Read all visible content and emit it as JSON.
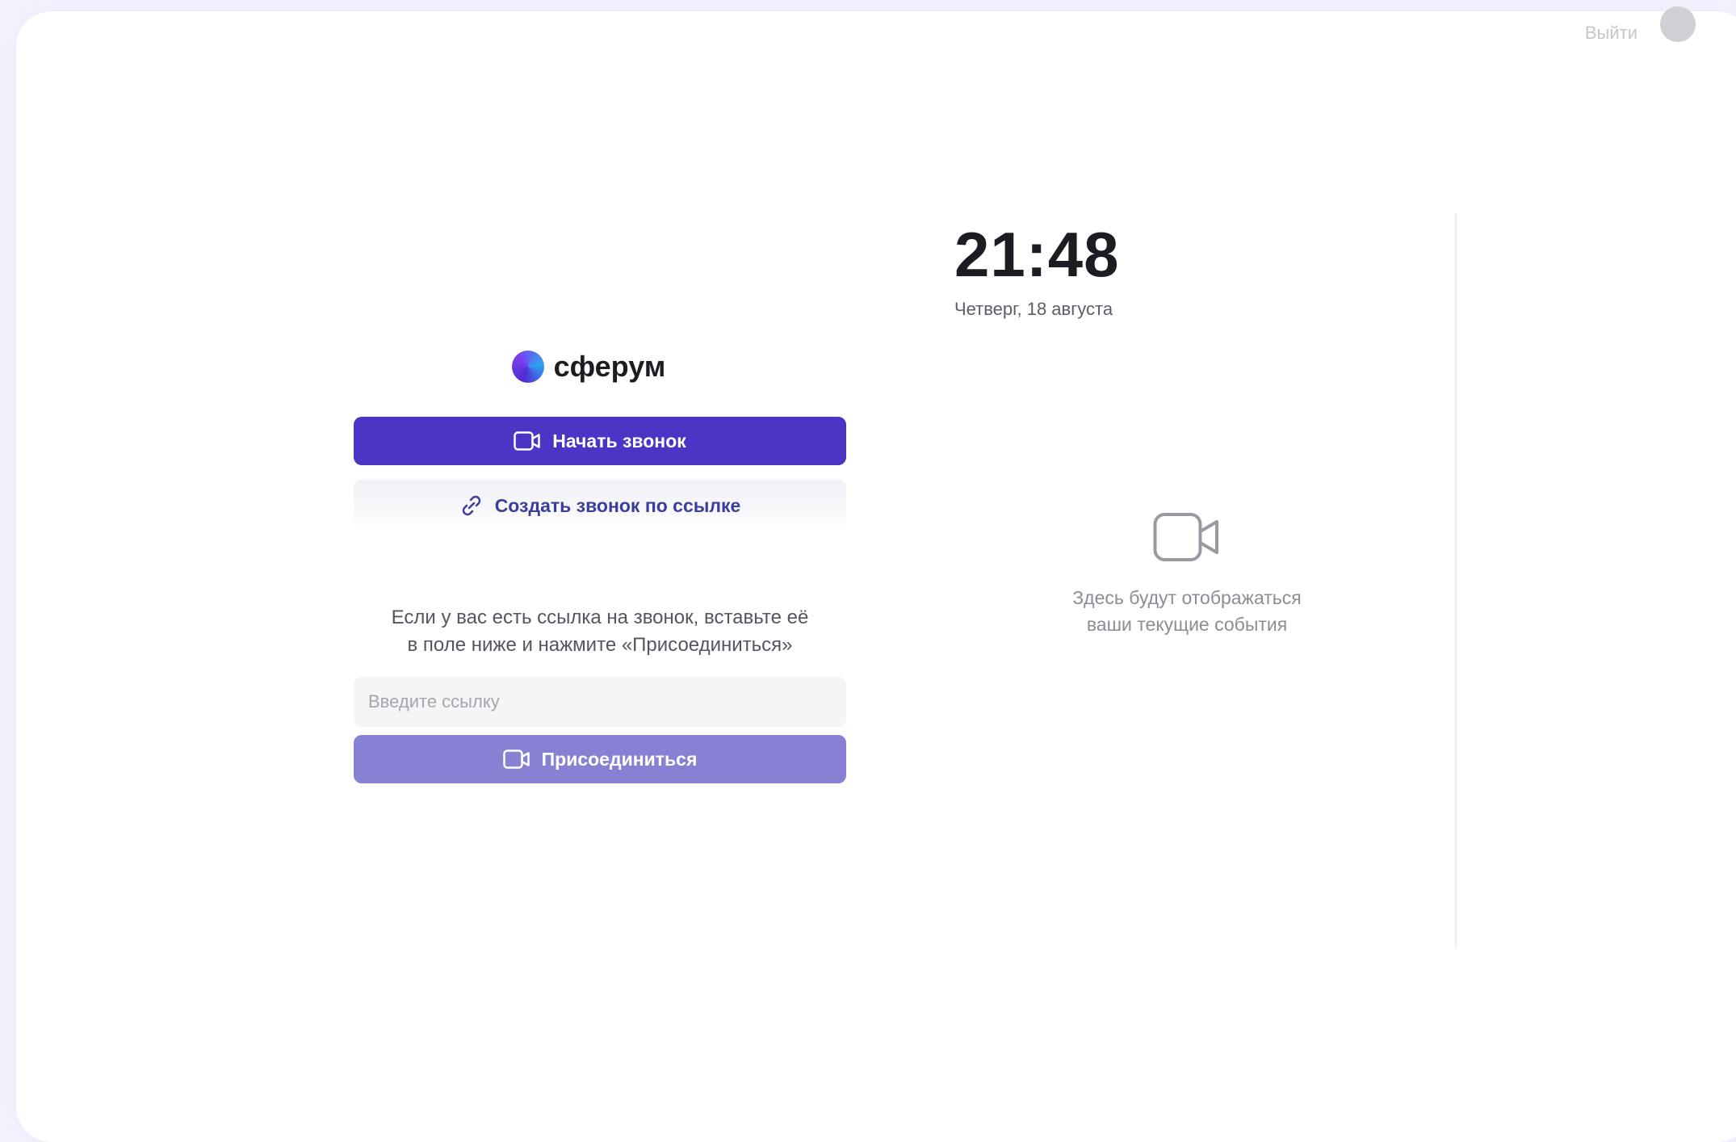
{
  "header": {
    "account_label": "Выйти"
  },
  "clock": {
    "time": "21:48",
    "date": "Четверг, 18 августа"
  },
  "brand": {
    "name": "сферум",
    "logo_icon": "sferum-logo-icon"
  },
  "actions": {
    "start_call_label": "Начать звонок",
    "start_call_icon": "video-camera-icon",
    "create_link_call_label": "Создать звонок по ссылке",
    "create_link_call_icon": "link-icon"
  },
  "join": {
    "hint": "Если у вас есть ссылка на звонок, вставьте её\nв поле ниже и нажмите «Присоединиться»",
    "input_value": "",
    "input_placeholder": "Введите ссылку",
    "join_label": "Присоединиться",
    "join_icon": "video-camera-icon"
  },
  "events": {
    "empty_icon": "video-camera-icon",
    "empty_text": "Здесь будут отображаться\nваши текущие события"
  },
  "colors": {
    "primary": "#4a35c4",
    "join_disabled": "#8880d3",
    "link_text": "#3b3e98",
    "page_background": "#f3f2fd"
  }
}
